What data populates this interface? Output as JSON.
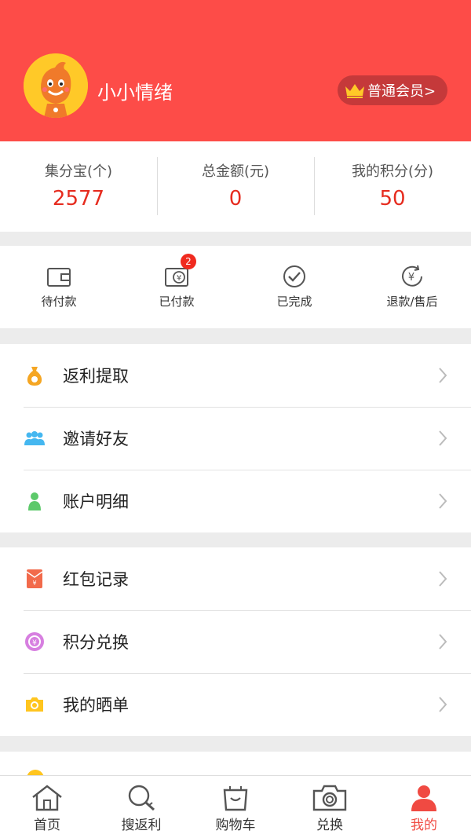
{
  "profile": {
    "username": "小小情绪",
    "member_label": "普通会员>"
  },
  "stats": [
    {
      "label": "集分宝(个)",
      "value": "2577"
    },
    {
      "label": "总金额(元)",
      "value": "0"
    },
    {
      "label": "我的积分(分)",
      "value": "50"
    }
  ],
  "orders": [
    {
      "label": "待付款",
      "icon": "wallet-icon"
    },
    {
      "label": "已付款",
      "icon": "paid-wallet-icon",
      "badge": "2"
    },
    {
      "label": "已完成",
      "icon": "check-circle-icon"
    },
    {
      "label": "退款/售后",
      "icon": "refund-icon"
    }
  ],
  "menu_group_1": [
    {
      "label": "返利提取",
      "icon": "money-bag-icon"
    },
    {
      "label": "邀请好友",
      "icon": "people-icon"
    },
    {
      "label": "账户明细",
      "icon": "user-icon"
    }
  ],
  "menu_group_2": [
    {
      "label": "红包记录",
      "icon": "red-envelope-icon"
    },
    {
      "label": "积分兑换",
      "icon": "exchange-icon"
    },
    {
      "label": "我的晒单",
      "icon": "camera-icon"
    }
  ],
  "tabbar": [
    {
      "label": "首页",
      "icon": "home-icon"
    },
    {
      "label": "搜返利",
      "icon": "search-icon"
    },
    {
      "label": "购物车",
      "icon": "cart-icon"
    },
    {
      "label": "兑换",
      "icon": "camera-icon"
    },
    {
      "label": "我的",
      "icon": "profile-icon",
      "active": true
    }
  ],
  "colors": {
    "brand_red": "#fd4c48",
    "value_red": "#e62c1f",
    "member_badge": "#c5393a"
  }
}
